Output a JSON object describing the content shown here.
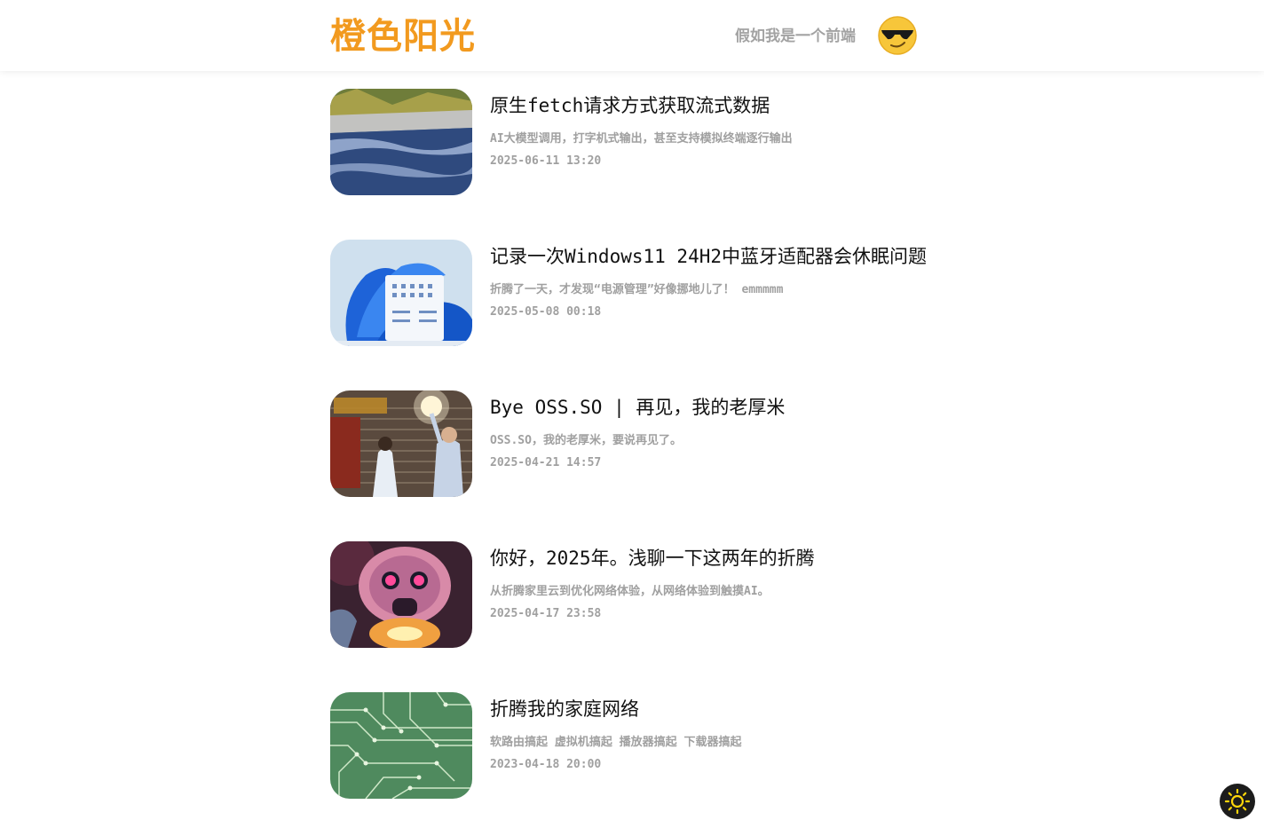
{
  "header": {
    "logo": "橙色阳光",
    "slogan": "假如我是一个前端",
    "avatar_icon": "sunglasses-emoji-icon",
    "logo_color": "#f29a1f"
  },
  "posts": [
    {
      "title": "原生fetch请求方式获取流式数据",
      "desc": "AI大模型调用，打字机式输出，甚至支持模拟终端逐行输出",
      "date": "2025-06-11 13:20",
      "thumb": "waterfall-image"
    },
    {
      "title": "记录一次Windows11 24H2中蓝牙适配器会休眠问题",
      "desc": "折腾了一天，才发现“电源管理”好像挪地儿了！ emmmmm",
      "date": "2025-05-08 00:18",
      "thumb": "windows11-image"
    },
    {
      "title": "Bye OSS.SO | 再见，我的老厚米",
      "desc": "OSS.SO，我的老厚米，要说再见了。",
      "date": "2025-04-21 14:57",
      "thumb": "movie-scene-image"
    },
    {
      "title": "你好，2025年。浅聊一下这两年的折腾",
      "desc": "从折腾家里云到优化网络体验，从网络体验到触摸AI。",
      "date": "2025-04-17 23:58",
      "thumb": "robot-image"
    },
    {
      "title": "折腾我的家庭网络",
      "desc": "软路由搞起 虚拟机搞起 播放器搞起 下载器搞起",
      "date": "2023-04-18 20:00",
      "thumb": "circuit-board-image"
    }
  ],
  "theme_toggle": {
    "icon": "sun-icon"
  }
}
